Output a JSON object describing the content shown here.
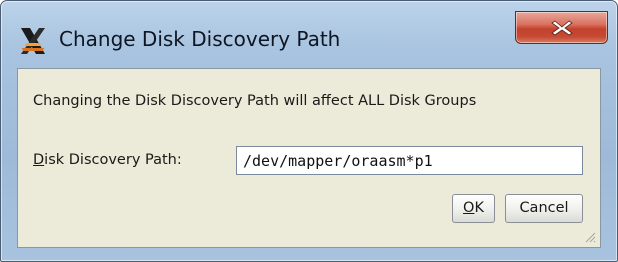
{
  "window": {
    "title": "Change Disk Discovery Path",
    "close_label": "X"
  },
  "dialog": {
    "message": "Changing the Disk Discovery Path will affect ALL Disk Groups",
    "path_label_mnemonic": "D",
    "path_label_rest": "isk Discovery Path:",
    "path_value": "/dev/mapper/oraasm*p1"
  },
  "buttons": {
    "ok_mnemonic": "O",
    "ok_rest": "K",
    "cancel_label": "Cancel"
  },
  "icons": {
    "app": "x-window-app-icon",
    "close": "close-icon",
    "grip": "resize-grip-icon"
  },
  "colors": {
    "title_bar": "#a9c4e0",
    "close_button": "#c64a34",
    "dialog_background": "#ecead8"
  }
}
